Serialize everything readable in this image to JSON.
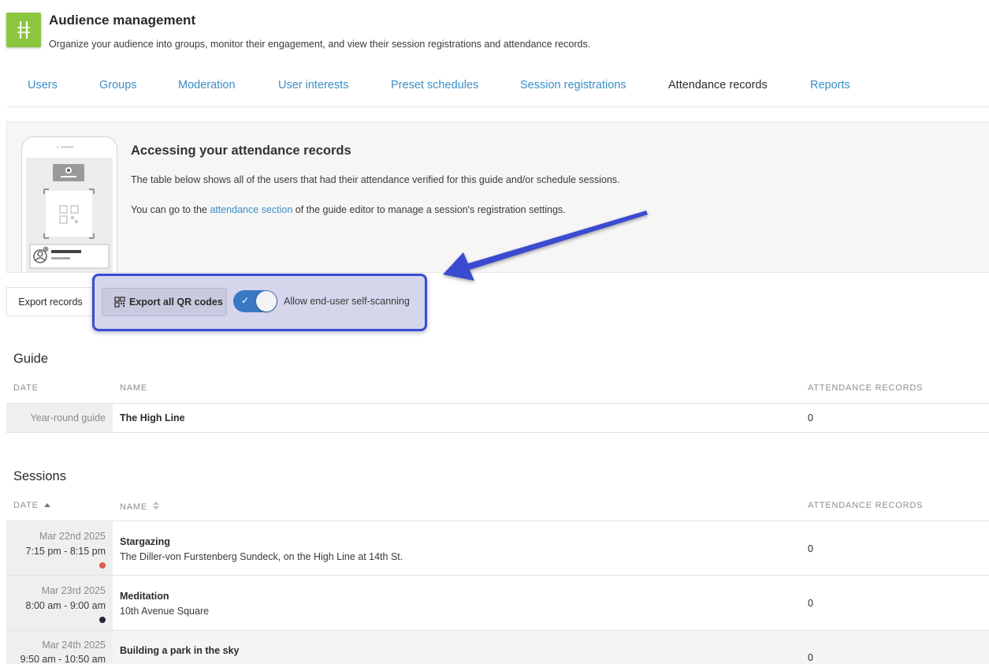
{
  "header": {
    "title": "Audience management",
    "subtitle": "Organize your audience into groups, monitor their engagement, and view their session registrations and attendance records.",
    "logo_icon": "guide-logo-icon",
    "logo_color": "#8cc63f"
  },
  "tabs": [
    {
      "label": "Users",
      "active": false
    },
    {
      "label": "Groups",
      "active": false
    },
    {
      "label": "Moderation",
      "active": false
    },
    {
      "label": "User interests",
      "active": false
    },
    {
      "label": "Preset schedules",
      "active": false
    },
    {
      "label": "Session registrations",
      "active": false
    },
    {
      "label": "Attendance records",
      "active": true
    },
    {
      "label": "Reports",
      "active": false
    }
  ],
  "info": {
    "title": "Accessing your attendance records",
    "line1": "The table below shows all of the users that had their attendance verified for this guide and/or schedule sessions.",
    "line2_prefix": "You can go to the ",
    "line2_link": "attendance section",
    "line2_suffix": " of the guide editor to manage a session's registration settings."
  },
  "actions": {
    "export_records": "Export records",
    "export_qr": "Export all QR codes",
    "self_scan_label": "Allow end-user self-scanning",
    "self_scan_enabled": true
  },
  "guide": {
    "title": "Guide",
    "columns": {
      "date": "DATE",
      "name": "NAME",
      "records": "ATTENDANCE RECORDS"
    },
    "row": {
      "date": "Year-round guide",
      "name": "The High Line",
      "records": "0"
    }
  },
  "sessions": {
    "title": "Sessions",
    "columns": {
      "date": "DATE",
      "name": "NAME",
      "records": "ATTENDANCE RECORDS"
    },
    "rows": [
      {
        "date": "Mar 22nd 2025",
        "time": "7:15 pm - 8:15 pm",
        "dot_color": "#e05a4f",
        "name": "Stargazing",
        "location": "The Diller-von Furstenberg Sundeck, on the High Line at 14th St.",
        "records": "0"
      },
      {
        "date": "Mar 23rd 2025",
        "time": "8:00 am - 9:00 am",
        "dot_color": "#222a36",
        "name": "Meditation",
        "location": "10th Avenue Square",
        "records": "0"
      },
      {
        "date": "Mar 24th 2025",
        "time": "9:50 am - 10:50 am",
        "dot_color": "",
        "name": "Building a park in the sky",
        "location": "",
        "records": "0"
      }
    ]
  },
  "colors": {
    "link": "#3a8fc7",
    "highlight_border": "#3b4bd0",
    "toggle_on": "#3b78c2"
  }
}
